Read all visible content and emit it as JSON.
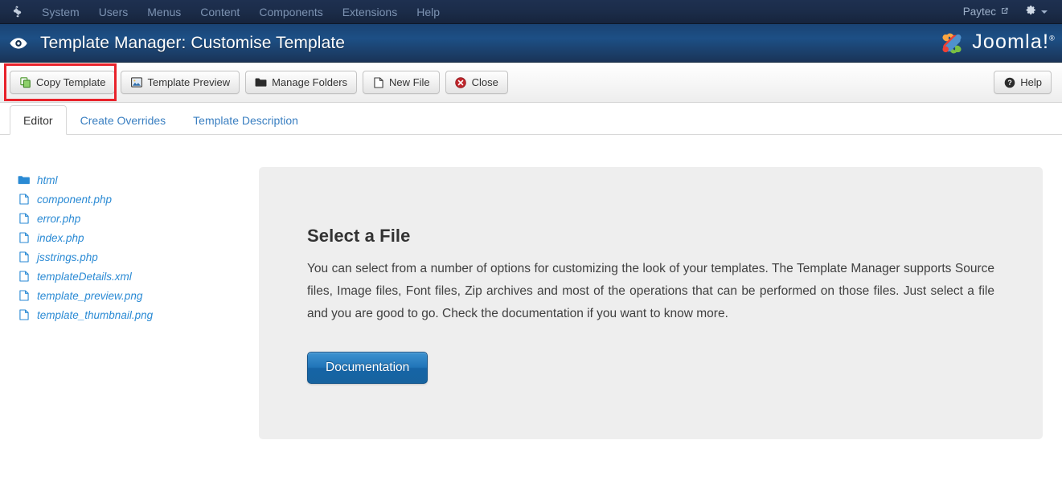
{
  "topbar": {
    "brand_icon": "joomla-brand-icon",
    "menu": [
      {
        "label": "System"
      },
      {
        "label": "Users"
      },
      {
        "label": "Menus"
      },
      {
        "label": "Content"
      },
      {
        "label": "Components"
      },
      {
        "label": "Extensions"
      },
      {
        "label": "Help"
      }
    ],
    "user": {
      "name": "Paytec",
      "icon": "external-link-icon"
    },
    "settings": {
      "icon": "gear-icon",
      "caret": "chevron-down-icon"
    }
  },
  "header": {
    "icon": "eye-icon",
    "title": "Template Manager: Customise Template",
    "logo_text": "Joomla!",
    "logo_reg": "®"
  },
  "toolbar": {
    "buttons": [
      {
        "label": "Copy Template",
        "icon": "copy-icon"
      },
      {
        "label": "Template Preview",
        "icon": "image-icon"
      },
      {
        "label": "Manage Folders",
        "icon": "folder-icon"
      },
      {
        "label": "New File",
        "icon": "file-icon"
      },
      {
        "label": "Close",
        "icon": "close-circle-icon"
      }
    ],
    "help": {
      "label": "Help",
      "icon": "help-circle-icon"
    }
  },
  "tabs": [
    {
      "label": "Editor",
      "active": true
    },
    {
      "label": "Create Overrides",
      "active": false
    },
    {
      "label": "Template Description",
      "active": false
    }
  ],
  "filetree": [
    {
      "name": "html",
      "type": "folder"
    },
    {
      "name": "component.php",
      "type": "file"
    },
    {
      "name": "error.php",
      "type": "file"
    },
    {
      "name": "index.php",
      "type": "file"
    },
    {
      "name": "jsstrings.php",
      "type": "file"
    },
    {
      "name": "templateDetails.xml",
      "type": "file"
    },
    {
      "name": "template_preview.png",
      "type": "file"
    },
    {
      "name": "template_thumbnail.png",
      "type": "file"
    }
  ],
  "panel": {
    "heading": "Select a File",
    "body": "You can select from a number of options for customizing the look of your templates. The Template Manager supports Source files, Image files, Font files, Zip archives and most of the operations that can be performed on those files. Just select a file and you are good to go. Check the documentation if you want to know more.",
    "button_label": "Documentation"
  },
  "colors": {
    "topbar_bg": "#1b2c49",
    "header_blue": "#1d4f85",
    "link_blue": "#2a8ad4",
    "tab_link": "#3a7fc1",
    "panel_bg": "#eeeeee",
    "doc_button": "#2175b8",
    "highlight_red": "#e8222a"
  }
}
